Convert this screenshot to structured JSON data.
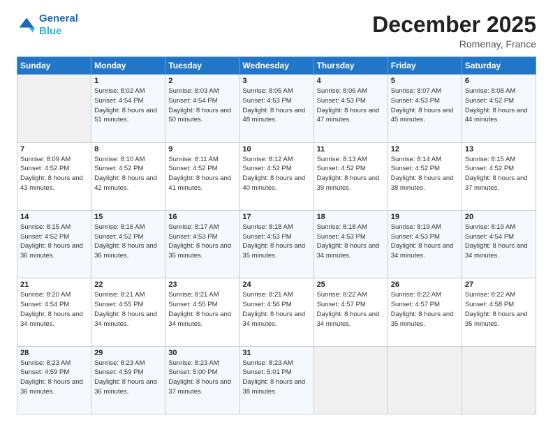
{
  "header": {
    "logo_line1": "General",
    "logo_line2": "Blue",
    "month": "December 2025",
    "location": "Romenay, France"
  },
  "weekdays": [
    "Sunday",
    "Monday",
    "Tuesday",
    "Wednesday",
    "Thursday",
    "Friday",
    "Saturday"
  ],
  "weeks": [
    [
      {
        "day": "",
        "sunrise": "",
        "sunset": "",
        "daylight": ""
      },
      {
        "day": "1",
        "sunrise": "Sunrise: 8:02 AM",
        "sunset": "Sunset: 4:54 PM",
        "daylight": "Daylight: 8 hours and 51 minutes."
      },
      {
        "day": "2",
        "sunrise": "Sunrise: 8:03 AM",
        "sunset": "Sunset: 4:54 PM",
        "daylight": "Daylight: 8 hours and 50 minutes."
      },
      {
        "day": "3",
        "sunrise": "Sunrise: 8:05 AM",
        "sunset": "Sunset: 4:53 PM",
        "daylight": "Daylight: 8 hours and 48 minutes."
      },
      {
        "day": "4",
        "sunrise": "Sunrise: 8:06 AM",
        "sunset": "Sunset: 4:53 PM",
        "daylight": "Daylight: 8 hours and 47 minutes."
      },
      {
        "day": "5",
        "sunrise": "Sunrise: 8:07 AM",
        "sunset": "Sunset: 4:53 PM",
        "daylight": "Daylight: 8 hours and 45 minutes."
      },
      {
        "day": "6",
        "sunrise": "Sunrise: 8:08 AM",
        "sunset": "Sunset: 4:52 PM",
        "daylight": "Daylight: 8 hours and 44 minutes."
      }
    ],
    [
      {
        "day": "7",
        "sunrise": "Sunrise: 8:09 AM",
        "sunset": "Sunset: 4:52 PM",
        "daylight": "Daylight: 8 hours and 43 minutes."
      },
      {
        "day": "8",
        "sunrise": "Sunrise: 8:10 AM",
        "sunset": "Sunset: 4:52 PM",
        "daylight": "Daylight: 8 hours and 42 minutes."
      },
      {
        "day": "9",
        "sunrise": "Sunrise: 8:11 AM",
        "sunset": "Sunset: 4:52 PM",
        "daylight": "Daylight: 8 hours and 41 minutes."
      },
      {
        "day": "10",
        "sunrise": "Sunrise: 8:12 AM",
        "sunset": "Sunset: 4:52 PM",
        "daylight": "Daylight: 8 hours and 40 minutes."
      },
      {
        "day": "11",
        "sunrise": "Sunrise: 8:13 AM",
        "sunset": "Sunset: 4:52 PM",
        "daylight": "Daylight: 8 hours and 39 minutes."
      },
      {
        "day": "12",
        "sunrise": "Sunrise: 8:14 AM",
        "sunset": "Sunset: 4:52 PM",
        "daylight": "Daylight: 8 hours and 38 minutes."
      },
      {
        "day": "13",
        "sunrise": "Sunrise: 8:15 AM",
        "sunset": "Sunset: 4:52 PM",
        "daylight": "Daylight: 8 hours and 37 minutes."
      }
    ],
    [
      {
        "day": "14",
        "sunrise": "Sunrise: 8:15 AM",
        "sunset": "Sunset: 4:52 PM",
        "daylight": "Daylight: 8 hours and 36 minutes."
      },
      {
        "day": "15",
        "sunrise": "Sunrise: 8:16 AM",
        "sunset": "Sunset: 4:52 PM",
        "daylight": "Daylight: 8 hours and 36 minutes."
      },
      {
        "day": "16",
        "sunrise": "Sunrise: 8:17 AM",
        "sunset": "Sunset: 4:53 PM",
        "daylight": "Daylight: 8 hours and 35 minutes."
      },
      {
        "day": "17",
        "sunrise": "Sunrise: 8:18 AM",
        "sunset": "Sunset: 4:53 PM",
        "daylight": "Daylight: 8 hours and 35 minutes."
      },
      {
        "day": "18",
        "sunrise": "Sunrise: 8:18 AM",
        "sunset": "Sunset: 4:53 PM",
        "daylight": "Daylight: 8 hours and 34 minutes."
      },
      {
        "day": "19",
        "sunrise": "Sunrise: 8:19 AM",
        "sunset": "Sunset: 4:53 PM",
        "daylight": "Daylight: 8 hours and 34 minutes."
      },
      {
        "day": "20",
        "sunrise": "Sunrise: 8:19 AM",
        "sunset": "Sunset: 4:54 PM",
        "daylight": "Daylight: 8 hours and 34 minutes."
      }
    ],
    [
      {
        "day": "21",
        "sunrise": "Sunrise: 8:20 AM",
        "sunset": "Sunset: 4:54 PM",
        "daylight": "Daylight: 8 hours and 34 minutes."
      },
      {
        "day": "22",
        "sunrise": "Sunrise: 8:21 AM",
        "sunset": "Sunset: 4:55 PM",
        "daylight": "Daylight: 8 hours and 34 minutes."
      },
      {
        "day": "23",
        "sunrise": "Sunrise: 8:21 AM",
        "sunset": "Sunset: 4:55 PM",
        "daylight": "Daylight: 8 hours and 34 minutes."
      },
      {
        "day": "24",
        "sunrise": "Sunrise: 8:21 AM",
        "sunset": "Sunset: 4:56 PM",
        "daylight": "Daylight: 8 hours and 34 minutes."
      },
      {
        "day": "25",
        "sunrise": "Sunrise: 8:22 AM",
        "sunset": "Sunset: 4:57 PM",
        "daylight": "Daylight: 8 hours and 34 minutes."
      },
      {
        "day": "26",
        "sunrise": "Sunrise: 8:22 AM",
        "sunset": "Sunset: 4:57 PM",
        "daylight": "Daylight: 8 hours and 35 minutes."
      },
      {
        "day": "27",
        "sunrise": "Sunrise: 8:22 AM",
        "sunset": "Sunset: 4:58 PM",
        "daylight": "Daylight: 8 hours and 35 minutes."
      }
    ],
    [
      {
        "day": "28",
        "sunrise": "Sunrise: 8:23 AM",
        "sunset": "Sunset: 4:59 PM",
        "daylight": "Daylight: 8 hours and 36 minutes."
      },
      {
        "day": "29",
        "sunrise": "Sunrise: 8:23 AM",
        "sunset": "Sunset: 4:59 PM",
        "daylight": "Daylight: 8 hours and 36 minutes."
      },
      {
        "day": "30",
        "sunrise": "Sunrise: 8:23 AM",
        "sunset": "Sunset: 5:00 PM",
        "daylight": "Daylight: 8 hours and 37 minutes."
      },
      {
        "day": "31",
        "sunrise": "Sunrise: 8:23 AM",
        "sunset": "Sunset: 5:01 PM",
        "daylight": "Daylight: 8 hours and 38 minutes."
      },
      {
        "day": "",
        "sunrise": "",
        "sunset": "",
        "daylight": ""
      },
      {
        "day": "",
        "sunrise": "",
        "sunset": "",
        "daylight": ""
      },
      {
        "day": "",
        "sunrise": "",
        "sunset": "",
        "daylight": ""
      }
    ]
  ]
}
